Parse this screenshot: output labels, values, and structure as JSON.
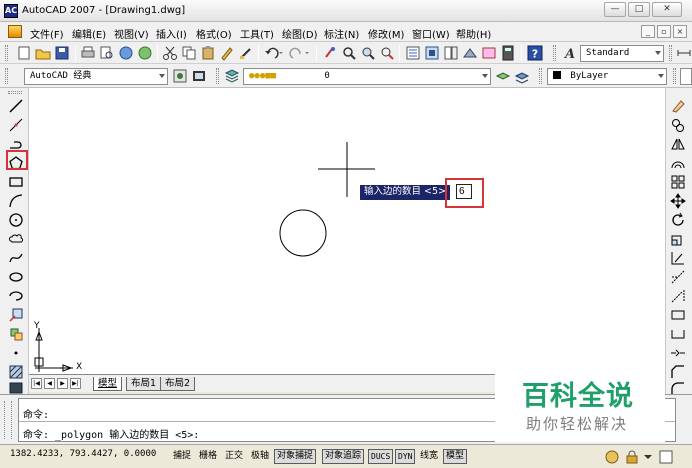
{
  "window": {
    "title": "AutoCAD 2007 - [Drawing1.dwg]",
    "app_icon_text": "AC"
  },
  "menu": {
    "items": [
      "文件(F)",
      "编辑(E)",
      "视图(V)",
      "插入(I)",
      "格式(O)",
      "工具(T)",
      "绘图(D)",
      "标注(N)",
      "修改(M)",
      "窗口(W)",
      "帮助(H)"
    ]
  },
  "toolbar1": {
    "text_style_combo": "Standard"
  },
  "toolbar2": {
    "workspace_combo": "AutoCAD 经典",
    "layer_combo": "0",
    "color_combo": "ByLayer"
  },
  "canvas": {
    "ucs_y_label": "Y",
    "ucs_x_label": "X"
  },
  "dynamic_input": {
    "prompt": "输入边的数目 <5>",
    "value": "6"
  },
  "tabs": [
    "模型",
    "布局1",
    "布局2"
  ],
  "nav_buttons": [
    "|◀",
    "◀",
    "▶",
    "▶|"
  ],
  "command": {
    "line1": "命令:",
    "line2": "命令: _polygon 输入边的数目 <5>:"
  },
  "status": {
    "coordinates": "1382.4233, 793.4427, 0.0000",
    "toggles": [
      {
        "label": "捕捉",
        "on": false
      },
      {
        "label": "栅格",
        "on": false
      },
      {
        "label": "正交",
        "on": false
      },
      {
        "label": "极轴",
        "on": false
      },
      {
        "label": "对象捕捉",
        "on": true
      },
      {
        "label": "对象追踪",
        "on": true
      },
      {
        "label": "DUCS",
        "on": true
      },
      {
        "label": "DYN",
        "on": true
      },
      {
        "label": "线宽",
        "on": false
      },
      {
        "label": "模型",
        "on": true
      }
    ]
  },
  "watermark": {
    "title": "百科全说",
    "subtitle": "助你轻松解决"
  },
  "colors": {
    "highlight_red": "#d9333a",
    "prompt_bg": "#1c2567",
    "watermark_green": "#1fa06a"
  }
}
